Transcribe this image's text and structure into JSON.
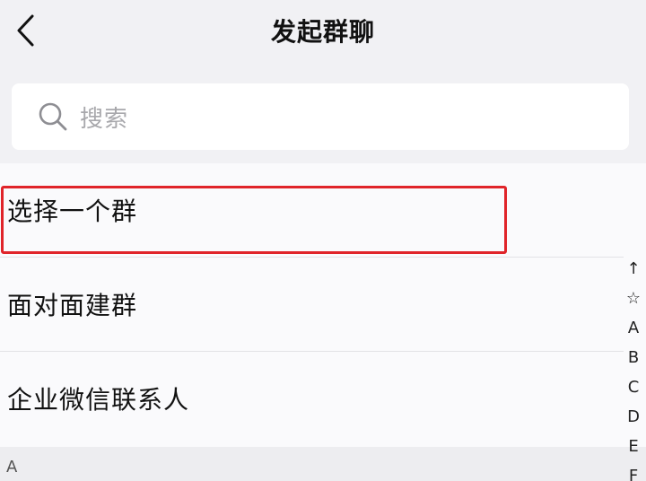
{
  "header": {
    "title": "发起群聊",
    "back_icon": "chevron-left-icon"
  },
  "search": {
    "placeholder": "搜索",
    "icon": "search-icon"
  },
  "list": {
    "items": [
      {
        "label": "选择一个群",
        "highlighted": true
      },
      {
        "label": "面对面建群",
        "highlighted": false
      },
      {
        "label": "企业微信联系人",
        "highlighted": false
      }
    ]
  },
  "section": {
    "letter": "A"
  },
  "index_bar": {
    "items": [
      "↑",
      "☆",
      "A",
      "B",
      "C",
      "D",
      "E",
      "F"
    ]
  },
  "colors": {
    "background": "#f1f1f4",
    "list_background": "#fafafc",
    "highlight": "#e0242a",
    "placeholder": "#a8a8ac"
  }
}
